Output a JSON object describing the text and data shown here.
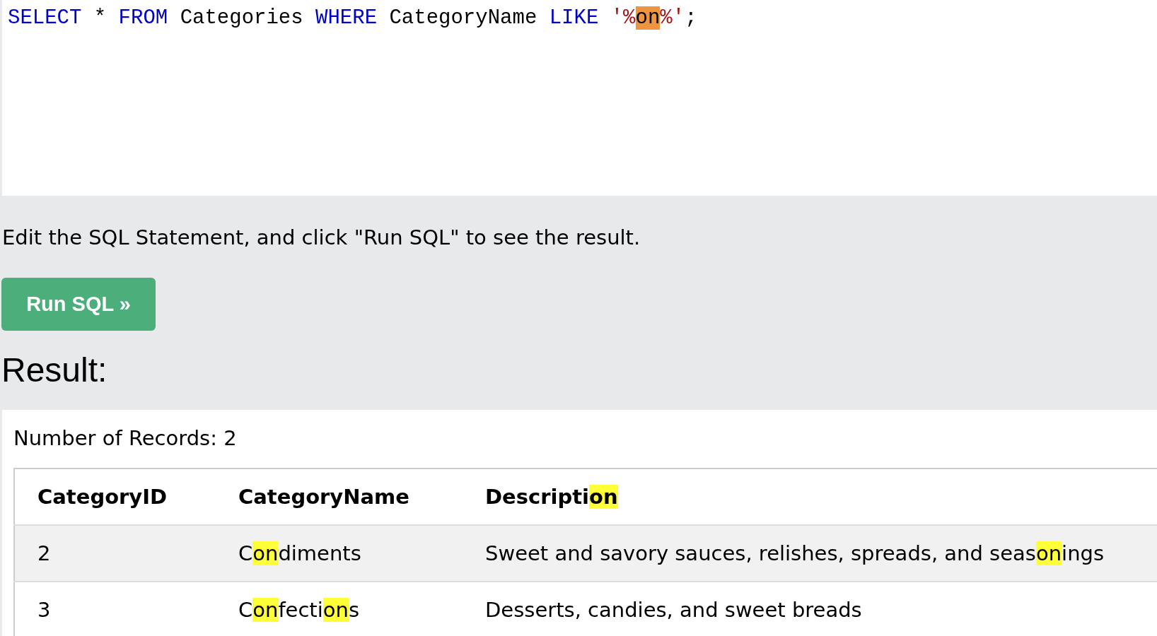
{
  "editor": {
    "tokens": [
      {
        "kind": "keyword",
        "segments": [
          {
            "text": "SELECT",
            "highlighted": false
          }
        ]
      },
      {
        "kind": "plain",
        "segments": [
          {
            "text": "*",
            "highlighted": false
          }
        ]
      },
      {
        "kind": "keyword",
        "segments": [
          {
            "text": "FROM",
            "highlighted": false
          }
        ]
      },
      {
        "kind": "plain",
        "segments": [
          {
            "text": "Categories",
            "highlighted": false
          }
        ]
      },
      {
        "kind": "keyword",
        "segments": [
          {
            "text": "WHERE",
            "highlighted": false
          }
        ]
      },
      {
        "kind": "plain",
        "segments": [
          {
            "text": "CategoryName",
            "highlighted": false
          }
        ]
      },
      {
        "kind": "keyword",
        "segments": [
          {
            "text": "LIKE",
            "highlighted": false
          }
        ]
      },
      {
        "kind": "string",
        "segments": [
          {
            "text": "'%",
            "highlighted": false
          },
          {
            "text": "on",
            "highlighted": true
          },
          {
            "text": "%'",
            "highlighted": false
          }
        ]
      },
      {
        "kind": "punctuation",
        "segments": [
          {
            "text": ";",
            "highlighted": false
          }
        ]
      }
    ]
  },
  "instruction": "Edit the SQL Statement, and click \"Run SQL\" to see the result.",
  "run_button": "Run SQL »",
  "result_heading": "Result:",
  "record_count": "Number of Records: 2",
  "table": {
    "columns": [
      {
        "segments": [
          {
            "text": "CategoryID",
            "highlighted": false
          }
        ]
      },
      {
        "segments": [
          {
            "text": "CategoryName",
            "highlighted": false
          }
        ]
      },
      {
        "segments": [
          {
            "text": "Descripti",
            "highlighted": false
          },
          {
            "text": "on",
            "highlighted": true
          }
        ]
      }
    ],
    "rows": [
      {
        "cells": [
          {
            "segments": [
              {
                "text": "2",
                "highlighted": false
              }
            ]
          },
          {
            "segments": [
              {
                "text": "C",
                "highlighted": false
              },
              {
                "text": "on",
                "highlighted": true
              },
              {
                "text": "diments",
                "highlighted": false
              }
            ]
          },
          {
            "segments": [
              {
                "text": "Sweet and savory sauces, relishes, spreads, and seas",
                "highlighted": false
              },
              {
                "text": "on",
                "highlighted": true
              },
              {
                "text": "ings",
                "highlighted": false
              }
            ]
          }
        ]
      },
      {
        "cells": [
          {
            "segments": [
              {
                "text": "3",
                "highlighted": false
              }
            ]
          },
          {
            "segments": [
              {
                "text": "C",
                "highlighted": false
              },
              {
                "text": "on",
                "highlighted": true
              },
              {
                "text": "fecti",
                "highlighted": false
              },
              {
                "text": "on",
                "highlighted": true
              },
              {
                "text": "s",
                "highlighted": false
              }
            ]
          },
          {
            "segments": [
              {
                "text": "Desserts, candies, and sweet breads",
                "highlighted": false
              }
            ]
          }
        ]
      }
    ]
  }
}
